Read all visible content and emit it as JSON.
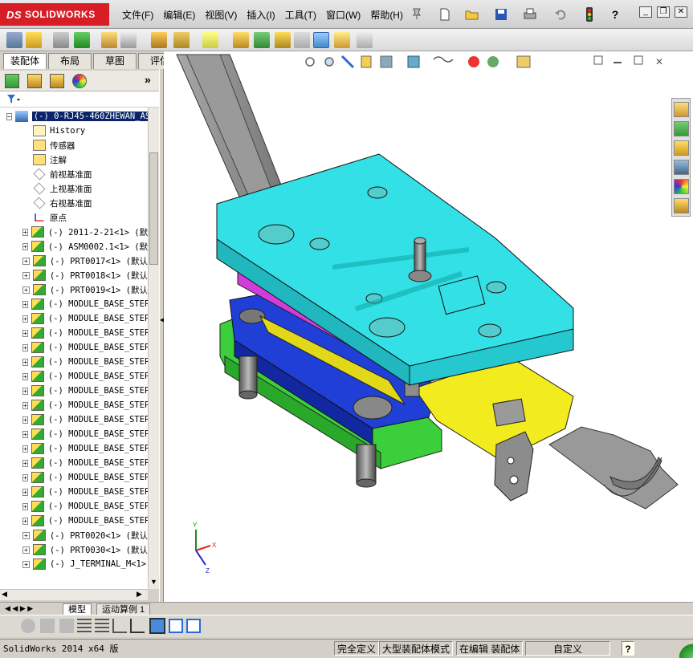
{
  "app": {
    "logo_ds": "DS",
    "logo_text": "SOLIDWORKS"
  },
  "menu": [
    "文件(F)",
    "编辑(E)",
    "视图(V)",
    "插入(I)",
    "工具(T)",
    "窗口(W)",
    "帮助(H)"
  ],
  "left_tabs": [
    "装配体",
    "布局",
    "草图",
    "评估"
  ],
  "tree": {
    "root_label": "(-) 0-RJ45-460ZHEWAN_AS",
    "features": [
      {
        "label": "History",
        "icon": "history-icon"
      },
      {
        "label": "传感器",
        "icon": "sensor-icon"
      },
      {
        "label": "注解",
        "icon": "annotation-icon"
      },
      {
        "label": "前视基准面",
        "icon": "plane-icon"
      },
      {
        "label": "上视基准面",
        "icon": "plane-icon"
      },
      {
        "label": "右视基准面",
        "icon": "plane-icon"
      },
      {
        "label": "原点",
        "icon": "origin-icon"
      }
    ],
    "components": [
      "(-) 2011-2-21<1> (默",
      "(-) ASM0002.1<1> (默",
      "(-) PRT0017<1> (默认",
      "(-) PRT0018<1> (默认",
      "(-) PRT0019<1> (默认",
      "(-) MODULE_BASE_STEP",
      "(-) MODULE_BASE_STEP",
      "(-) MODULE_BASE_STEP",
      "(-) MODULE_BASE_STEP",
      "(-) MODULE_BASE_STEP",
      "(-) MODULE_BASE_STEP",
      "(-) MODULE_BASE_STEP",
      "(-) MODULE_BASE_STEP",
      "(-) MODULE_BASE_STEP",
      "(-) MODULE_BASE_STEP",
      "(-) MODULE_BASE_STEP",
      "(-) MODULE_BASE_STEP",
      "(-) MODULE_BASE_STEP",
      "(-) MODULE_BASE_STEP",
      "(-) MODULE_BASE_STEP",
      "(-) MODULE_BASE_STEP",
      "(-) PRT0020<1> (默认",
      "(-) PRT0030<1> (默认",
      "(-) J_TERMINAL_M<1>"
    ]
  },
  "bottom_tabs": [
    "模型",
    "运动算例 1"
  ],
  "triad": {
    "x": "X",
    "y": "Y",
    "z": "Z"
  },
  "status": {
    "version": "SolidWorks 2014 x64 版",
    "definition": "完全定义",
    "mode": "大型装配体模式",
    "editing": "在编辑 装配体",
    "units": "自定义",
    "help": "?"
  },
  "colors": {
    "brand": "#d71e26",
    "cyan_plate": "#33e0e6",
    "magenta_plate": "#d23cdc",
    "blue_plate": "#1f3fd6",
    "green_plate": "#3ccf3c",
    "yellow_plate": "#f2ec1e",
    "steel": "#8c8c8c"
  }
}
